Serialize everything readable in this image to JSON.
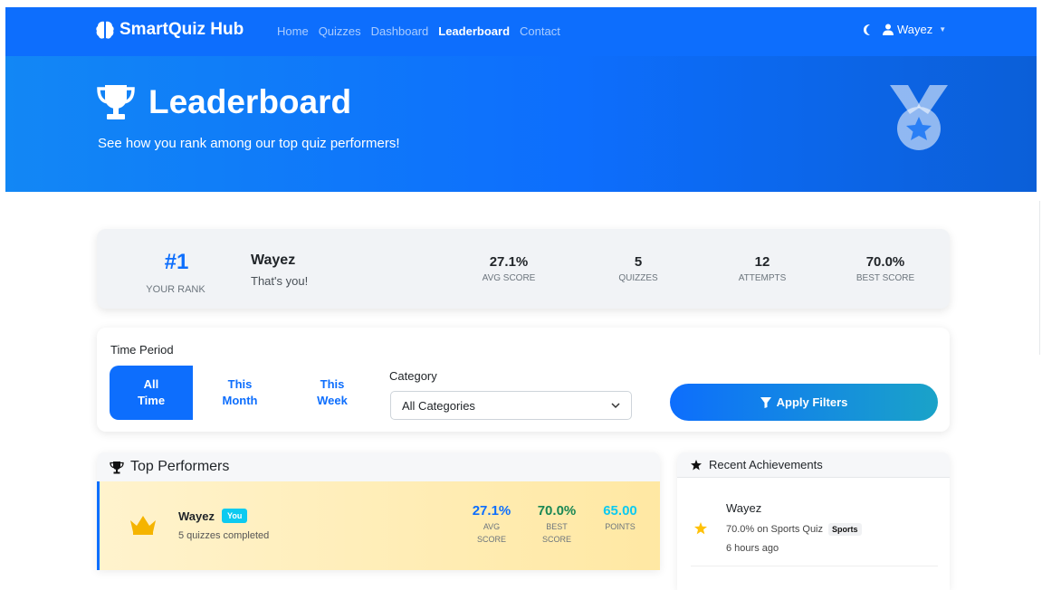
{
  "nav": {
    "brand": "SmartQuiz Hub",
    "links": [
      {
        "label": "Home",
        "active": false
      },
      {
        "label": "Quizzes",
        "active": false
      },
      {
        "label": "Dashboard",
        "active": false
      },
      {
        "label": "Leaderboard",
        "active": true
      },
      {
        "label": "Contact",
        "active": false
      }
    ],
    "user": "Wayez"
  },
  "hero": {
    "title": "Leaderboard",
    "subtitle": "See how you rank among our top quiz performers!"
  },
  "rank": {
    "rank": "#1",
    "rank_label": "YOUR RANK",
    "name": "Wayez",
    "note": "That's you!",
    "stats": [
      {
        "value": "27.1%",
        "label": "AVG SCORE"
      },
      {
        "value": "5",
        "label": "QUIZZES"
      },
      {
        "value": "12",
        "label": "ATTEMPTS"
      },
      {
        "value": "70.0%",
        "label": "BEST SCORE"
      }
    ]
  },
  "filters": {
    "time_label": "Time Period",
    "periods": [
      {
        "line1": "All",
        "line2": "Time",
        "active": true
      },
      {
        "line1": "This",
        "line2": "Month",
        "active": false
      },
      {
        "line1": "This",
        "line2": "Week",
        "active": false
      }
    ],
    "category_label": "Category",
    "category_value": "All Categories",
    "apply_label": "Apply Filters"
  },
  "top_performers": {
    "title": "Top Performers",
    "entry": {
      "name": "Wayez",
      "badge": "You",
      "subtitle": "5 quizzes completed",
      "stats": [
        {
          "value": "27.1%",
          "label1": "AVG",
          "label2": "SCORE",
          "color": "#0d6efd"
        },
        {
          "value": "70.0%",
          "label1": "BEST",
          "label2": "SCORE",
          "color": "#198754"
        },
        {
          "value": "65.00",
          "label1": "POINTS",
          "label2": "",
          "color": "#0dcaf0"
        }
      ]
    }
  },
  "achievements": {
    "title": "Recent Achievements",
    "item": {
      "name": "Wayez",
      "description": "70.0% on Sports Quiz",
      "category": "Sports",
      "time": "6 hours ago"
    }
  },
  "colors": {
    "primary": "#0d6efd",
    "success": "#198754",
    "info": "#0dcaf0",
    "gold": "#ffc107"
  }
}
